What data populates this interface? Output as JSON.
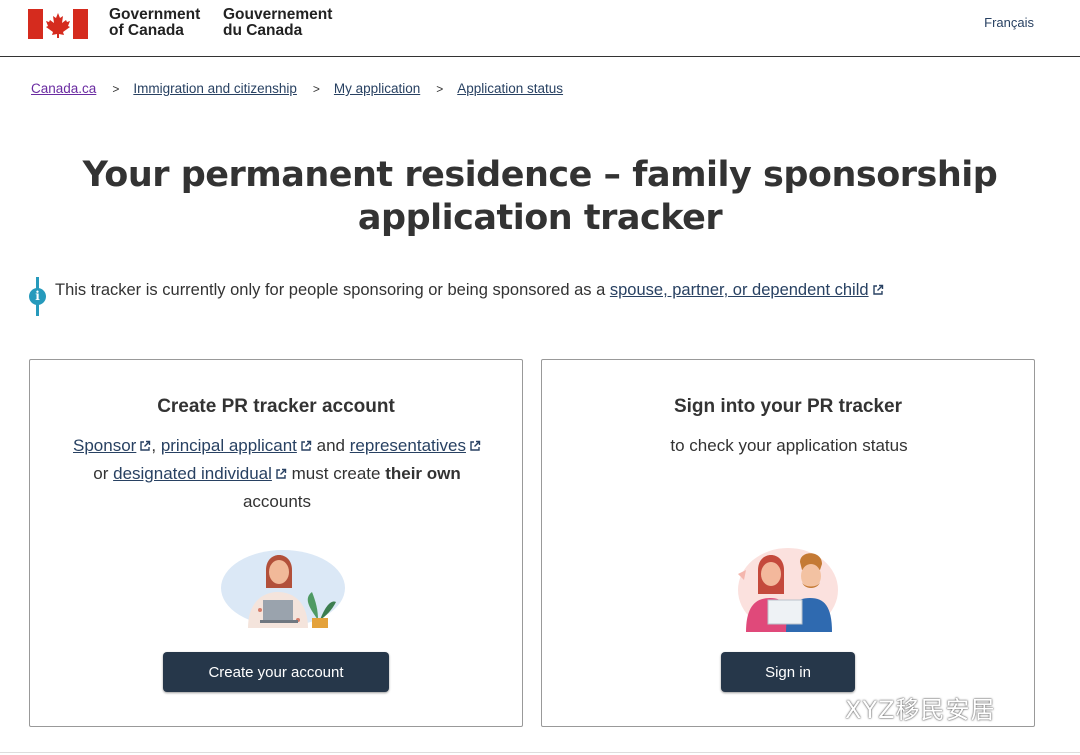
{
  "header": {
    "wordmark_en_line1": "Government",
    "wordmark_en_line2": "of Canada",
    "wordmark_fr_line1": "Gouvernement",
    "wordmark_fr_line2": "du Canada",
    "language_link": "Français",
    "flag_color": "#d52b1e"
  },
  "breadcrumb": {
    "items": [
      "Canada.ca",
      "Immigration and citizenship",
      "My application",
      "Application status"
    ],
    "separator": ">"
  },
  "page": {
    "title_line1": "Your permanent residence – family sponsorship",
    "title_line2": "application tracker"
  },
  "info": {
    "text": "This tracker is currently only for people sponsoring or being sponsored as a ",
    "link": "spouse, partner, or dependent child",
    "icon": "info-icon"
  },
  "create_card": {
    "title": "Create PR tracker account",
    "link_sponsor": "Sponsor",
    "comma": ",",
    "link_principal": "principal applicant",
    "and_text": "and",
    "link_representatives": "representatives",
    "or_text": "or",
    "link_designated": "designated individual",
    "must_text": "must create",
    "their_own": "their own",
    "accounts_text": "accounts",
    "button": "Create your account"
  },
  "signin_card": {
    "title": "Sign into your PR tracker",
    "subtitle": "to check your application status",
    "button": "Sign in"
  },
  "watermark": "XYZ移民安居",
  "colors": {
    "link": "#284162",
    "visited_link": "#6a2ba1",
    "button_bg": "#26374a",
    "info_accent": "#269abc"
  }
}
